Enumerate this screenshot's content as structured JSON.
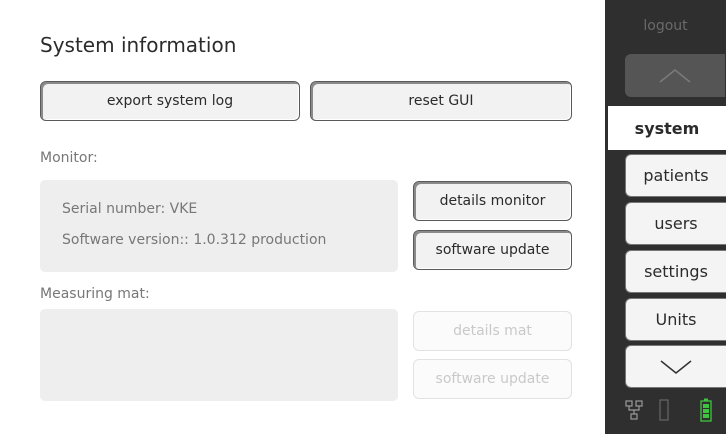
{
  "page": {
    "title": "System information"
  },
  "actions": {
    "export_label": "export system log",
    "reset_label": "reset GUI"
  },
  "monitor": {
    "label": "Monitor:",
    "serial": "Serial number: VKE",
    "software": "Software version:: 1.0.312 production",
    "details_label": "details monitor",
    "update_label": "software update"
  },
  "mat": {
    "label": "Measuring mat:",
    "details_label": "details mat",
    "update_label": "software update"
  },
  "sidebar": {
    "logout": "logout",
    "tabs": [
      {
        "label": "system",
        "active": true
      },
      {
        "label": "patients",
        "active": false
      },
      {
        "label": "users",
        "active": false
      },
      {
        "label": "settings",
        "active": false
      },
      {
        "label": "Units",
        "active": false
      }
    ],
    "status_icons": [
      "network-icon",
      "measuring-mat-icon",
      "battery-icon"
    ]
  },
  "colors": {
    "sidebar_bg": "#2f2f2f",
    "accent_battery": "#3ec43e"
  }
}
